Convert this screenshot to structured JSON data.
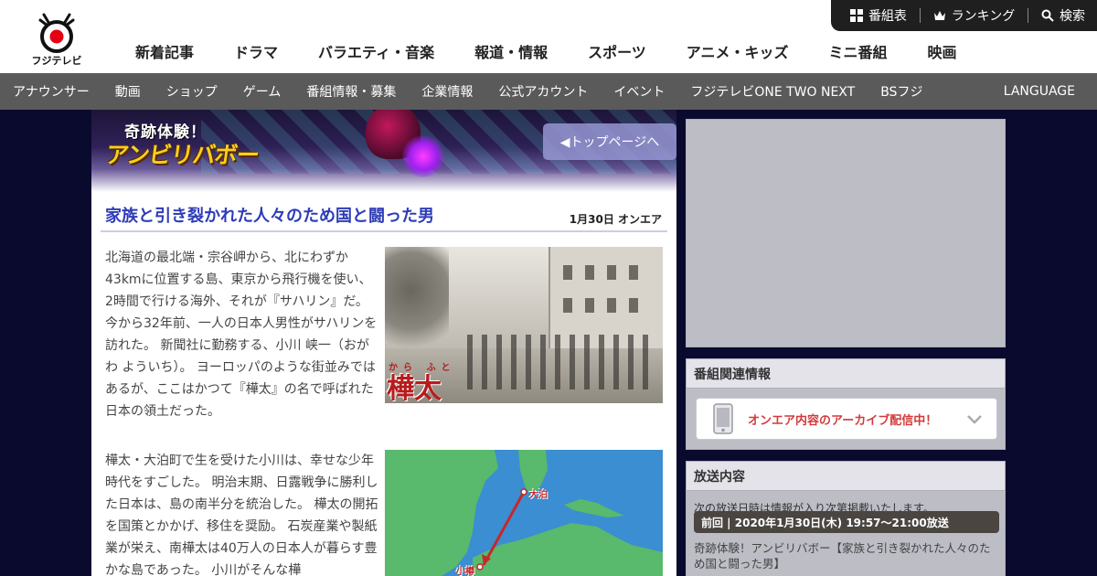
{
  "header": {
    "logo_text": "フジテレビ",
    "util": [
      {
        "icon": "grid-icon",
        "label": "番組表"
      },
      {
        "icon": "crown-icon",
        "label": "ランキング"
      },
      {
        "icon": "search-icon",
        "label": "検索"
      }
    ],
    "mainnav": [
      "新着記事",
      "ドラマ",
      "バラエティ・音楽",
      "報道・情報",
      "スポーツ",
      "アニメ・キッズ",
      "ミニ番組",
      "映画"
    ]
  },
  "subnav": {
    "items": [
      "アナウンサー",
      "動画",
      "ショップ",
      "ゲーム",
      "番組情報・募集",
      "企業情報",
      "公式アカウント",
      "イベント",
      "フジテレビONE TWO NEXT",
      "BSフジ"
    ],
    "language": "LANGUAGE"
  },
  "banner": {
    "subtitle": "奇跡体験！",
    "title": "アンビリバボー",
    "top_button": "◀トップページへ"
  },
  "article": {
    "title": "家族と引き裂かれた人々のため国と闘った男",
    "date": "1月30日 オンエア",
    "paragraph1": "北海道の最北端・宗谷岬から、北にわずか43kmに位置する島、東京から飛行機を使い、2時間で行ける海外、それが『サハリン』だ。 今から32年前、一人の日本人男性がサハリンを訪れた。 新聞社に勤務する、小川 峡一（おがわ よういち）。 ヨーロッパのような街並みではあるが、ここはかつて『樺太』の名で呼ばれた日本の領土だった。",
    "paragraph2": "樺太・大泊町で生を受けた小川は、幸せな少年時代をすごした。 明治末期、日露戦争に勝利した日本は、島の南半分を統治した。 樺太の開拓を国策とかかげ、移住を奨励。 石炭産業や製紙業が栄え、南樺太は40万人の日本人が暮らす豊かな島であった。 小川がそんな樺",
    "photo_caption": "樺太",
    "photo_ruby": "から ふと",
    "map_labels": {
      "north": "大泊",
      "south": "小樽"
    }
  },
  "sidebar": {
    "related": {
      "heading": "番組関連情報",
      "archive_label": "オンエア内容のアーカイブ配信中！"
    },
    "broadcast": {
      "heading": "放送内容",
      "note": "次の放送日時は情報が入り次第掲載いたします。",
      "previous": "前回 | 2020年1月30日(木) 19:57～21:00放送",
      "description": "奇跡体験！アンビリバボー【家族と引き裂かれた人々のため国と闘った男】"
    }
  },
  "colors": {
    "background": "#0a0a2e",
    "title_blue": "#2e3cb8",
    "archive_red": "#d33a3a",
    "subnav_gray": "#5a5a5a"
  }
}
